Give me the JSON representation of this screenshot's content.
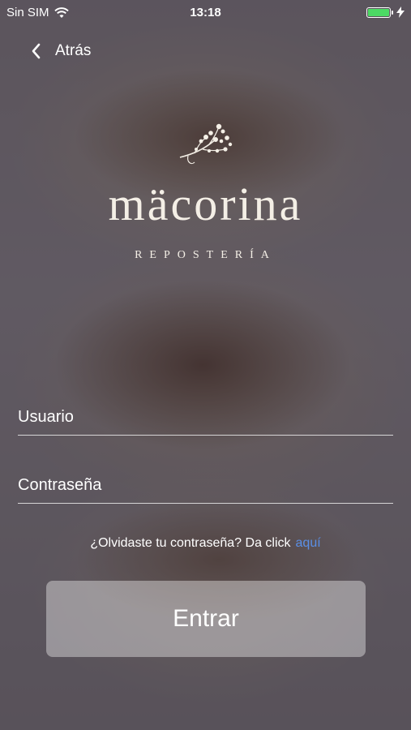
{
  "status_bar": {
    "carrier": "Sin SIM",
    "time": "13:18",
    "battery_level": 1.0,
    "battery_color": "#4cd964"
  },
  "nav": {
    "back_label": "Atrás",
    "back_icon": "chevron-left-icon"
  },
  "brand": {
    "logo_icon": "flower-branch-icon",
    "name": "mäcorina",
    "subtitle": "REPOSTERÍA"
  },
  "form": {
    "username_placeholder": "Usuario",
    "password_placeholder": "Contraseña",
    "forgot_text": "¿Olvidaste tu contraseña? Da click",
    "forgot_link": "aquí",
    "link_color": "#5a8fe6",
    "submit_label": "Entrar"
  }
}
